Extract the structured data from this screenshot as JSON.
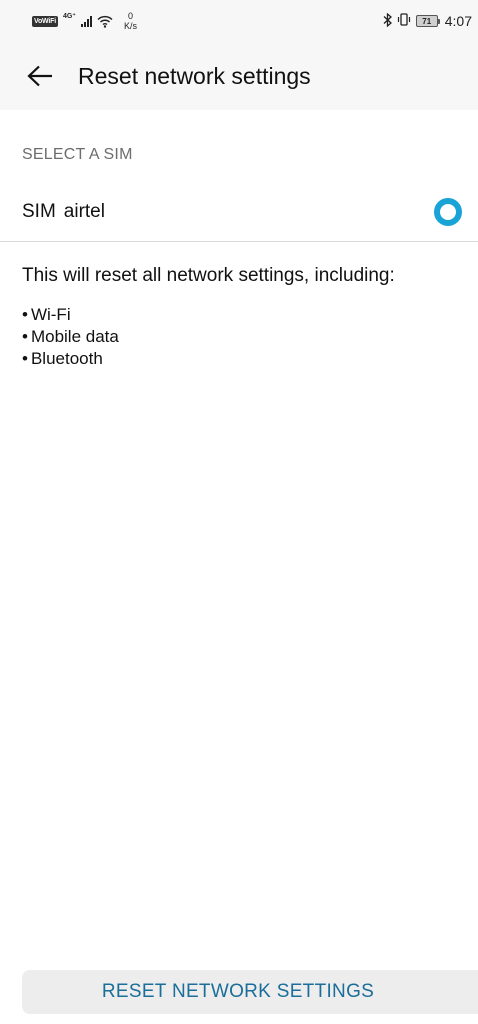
{
  "status_bar": {
    "vowifi": "VoWiFi",
    "network_type": "4G⁺",
    "speed_value": "0",
    "speed_unit": "K/s",
    "battery": "71",
    "time": "4:07"
  },
  "header": {
    "title": "Reset network settings"
  },
  "sim_section": {
    "header": "SELECT A SIM",
    "sim_prefix": "SIM",
    "sim_name": "airtel",
    "selected": true
  },
  "info": {
    "description": "This will reset all network settings, including:",
    "items": [
      "Wi-Fi",
      "Mobile data",
      "Bluetooth"
    ]
  },
  "actions": {
    "reset_label": "RESET NETWORK SETTINGS"
  },
  "colors": {
    "accent": "#1aa3d6",
    "button_text": "#1a6e99"
  }
}
